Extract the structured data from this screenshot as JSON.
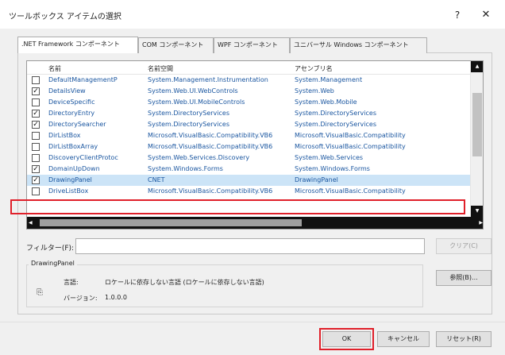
{
  "window": {
    "title": "ツールボックス アイテムの選択",
    "help_label": "?",
    "close_label": "✕"
  },
  "tabs": [
    {
      "label": ".NET Framework コンポーネント",
      "active": true
    },
    {
      "label": "COM コンポーネント",
      "active": false
    },
    {
      "label": "WPF コンポーネント",
      "active": false
    },
    {
      "label": "ユニバーサル Windows コンポーネント",
      "active": false
    }
  ],
  "grid": {
    "columns": [
      "名前",
      "名前空間",
      "アセンブリ名"
    ],
    "rows": [
      {
        "checked": false,
        "name": "DefaultManagementP",
        "namespace": "System.Management.Instrumentation",
        "assembly": "System.Management"
      },
      {
        "checked": true,
        "name": "DetailsView",
        "namespace": "System.Web.UI.WebControls",
        "assembly": "System.Web"
      },
      {
        "checked": false,
        "name": "DeviceSpecific",
        "namespace": "System.Web.UI.MobileControls",
        "assembly": "System.Web.Mobile"
      },
      {
        "checked": true,
        "name": "DirectoryEntry",
        "namespace": "System.DirectoryServices",
        "assembly": "System.DirectoryServices"
      },
      {
        "checked": true,
        "name": "DirectorySearcher",
        "namespace": "System.DirectoryServices",
        "assembly": "System.DirectoryServices"
      },
      {
        "checked": false,
        "name": "DirListBox",
        "namespace": "Microsoft.VisualBasic.Compatibility.VB6",
        "assembly": "Microsoft.VisualBasic.Compatibility"
      },
      {
        "checked": false,
        "name": "DirListBoxArray",
        "namespace": "Microsoft.VisualBasic.Compatibility.VB6",
        "assembly": "Microsoft.VisualBasic.Compatibility"
      },
      {
        "checked": false,
        "name": "DiscoveryClientProtoc",
        "namespace": "System.Web.Services.Discovery",
        "assembly": "System.Web.Services"
      },
      {
        "checked": true,
        "name": "DomainUpDown",
        "namespace": "System.Windows.Forms",
        "assembly": "System.Windows.Forms"
      },
      {
        "checked": true,
        "name": "DrawingPanel",
        "namespace": "CNET",
        "assembly": "DrawingPanel",
        "selected": true
      },
      {
        "checked": false,
        "name": "DriveListBox",
        "namespace": "Microsoft.VisualBasic.Compatibility.VB6",
        "assembly": "Microsoft.VisualBasic.Compatibility"
      }
    ]
  },
  "filter": {
    "label": "フィルター(F):",
    "value": "",
    "clear_label": "クリア(C)"
  },
  "details": {
    "title": "DrawingPanel",
    "language_label": "言語:",
    "language_value": "ロケールに依存しない言語 (ロケールに依存しない言語)",
    "version_label": "バージョン:",
    "version_value": "1.0.0.0",
    "icon": "component-icon",
    "browse_label": "参照(B)..."
  },
  "footer": {
    "ok_label": "OK",
    "cancel_label": "キャンセル",
    "reset_label": "リセット(R)"
  }
}
